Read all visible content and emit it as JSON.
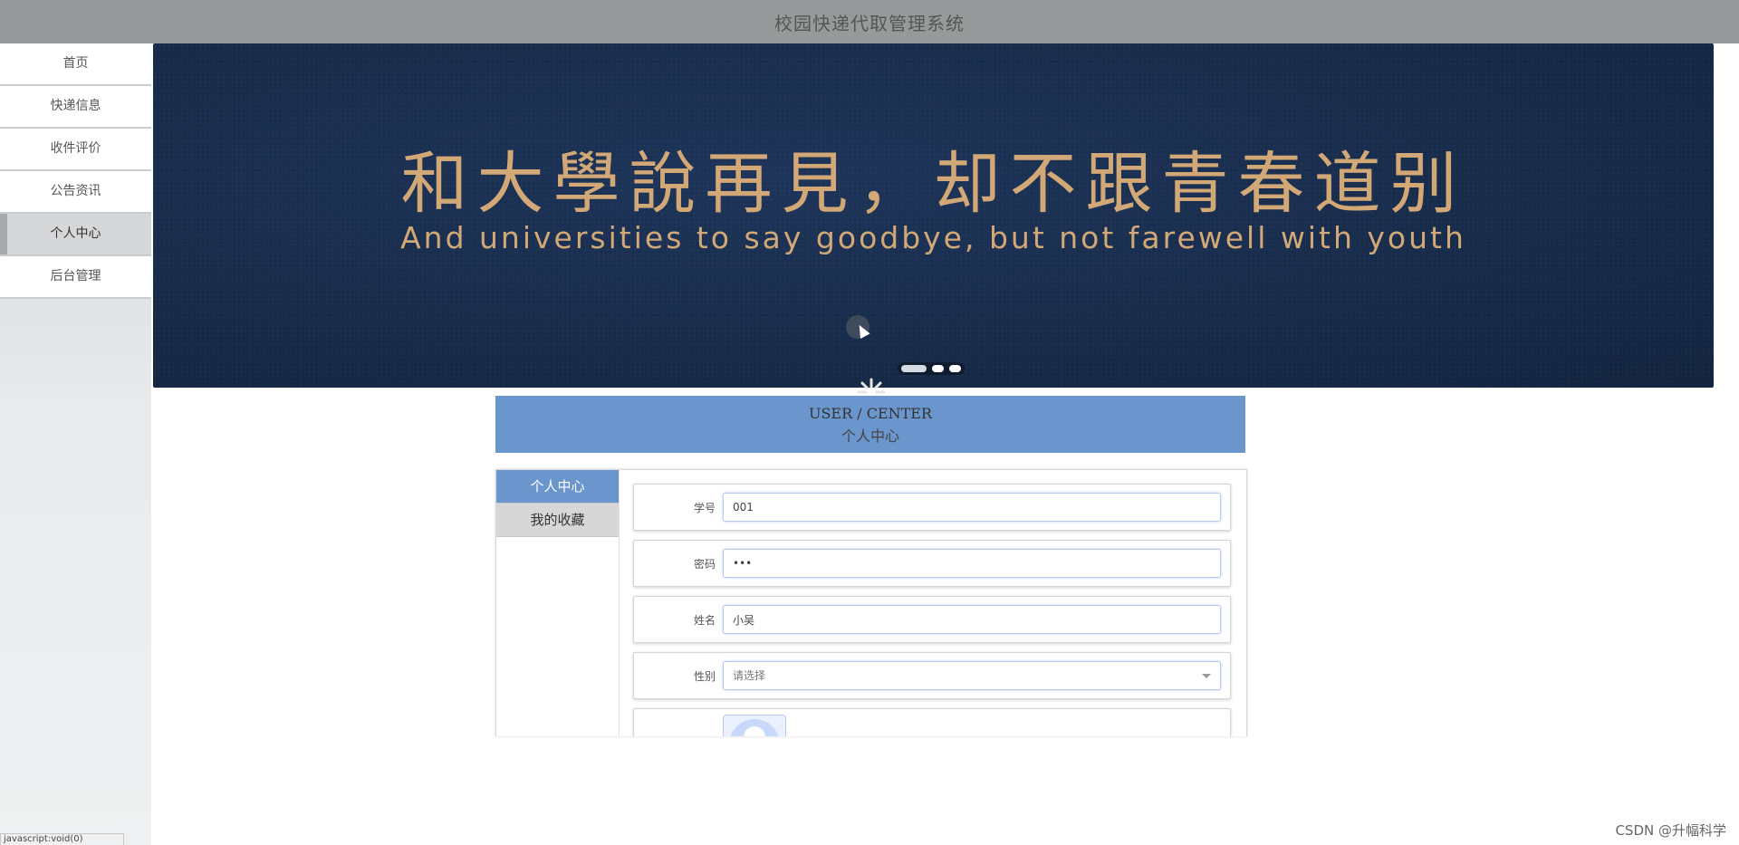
{
  "app": {
    "title": "校园快递代取管理系统"
  },
  "sidebar": {
    "items": [
      {
        "label": "首页"
      },
      {
        "label": "快递信息"
      },
      {
        "label": "收件评价"
      },
      {
        "label": "公告资讯"
      },
      {
        "label": "个人中心",
        "active": true
      },
      {
        "label": "后台管理"
      }
    ]
  },
  "banner": {
    "title": "和大學說再見，却不跟青春道别",
    "subtitle": "And universities to say goodbye, but not farewell with youth",
    "slides_total": 3,
    "active_slide": 1
  },
  "user_center": {
    "title_en": "USER / CENTER",
    "title_cn": "个人中心"
  },
  "tabs": [
    {
      "label": "个人中心",
      "active": true
    },
    {
      "label": "我的收藏"
    }
  ],
  "form": {
    "student_id": {
      "label": "学号",
      "value": "001"
    },
    "password": {
      "label": "密码",
      "value": "•••"
    },
    "name": {
      "label": "姓名",
      "value": "小吴"
    },
    "gender": {
      "label": "性别",
      "placeholder": "请选择"
    }
  },
  "status_bar": {
    "url": "javascript:void(0)"
  },
  "watermark": "CSDN @升幅科学",
  "colors": {
    "topbar": "#979a9a",
    "accent": "#6a96cd",
    "banner_bg": "#182c4b",
    "banner_text": "#d3a877"
  }
}
